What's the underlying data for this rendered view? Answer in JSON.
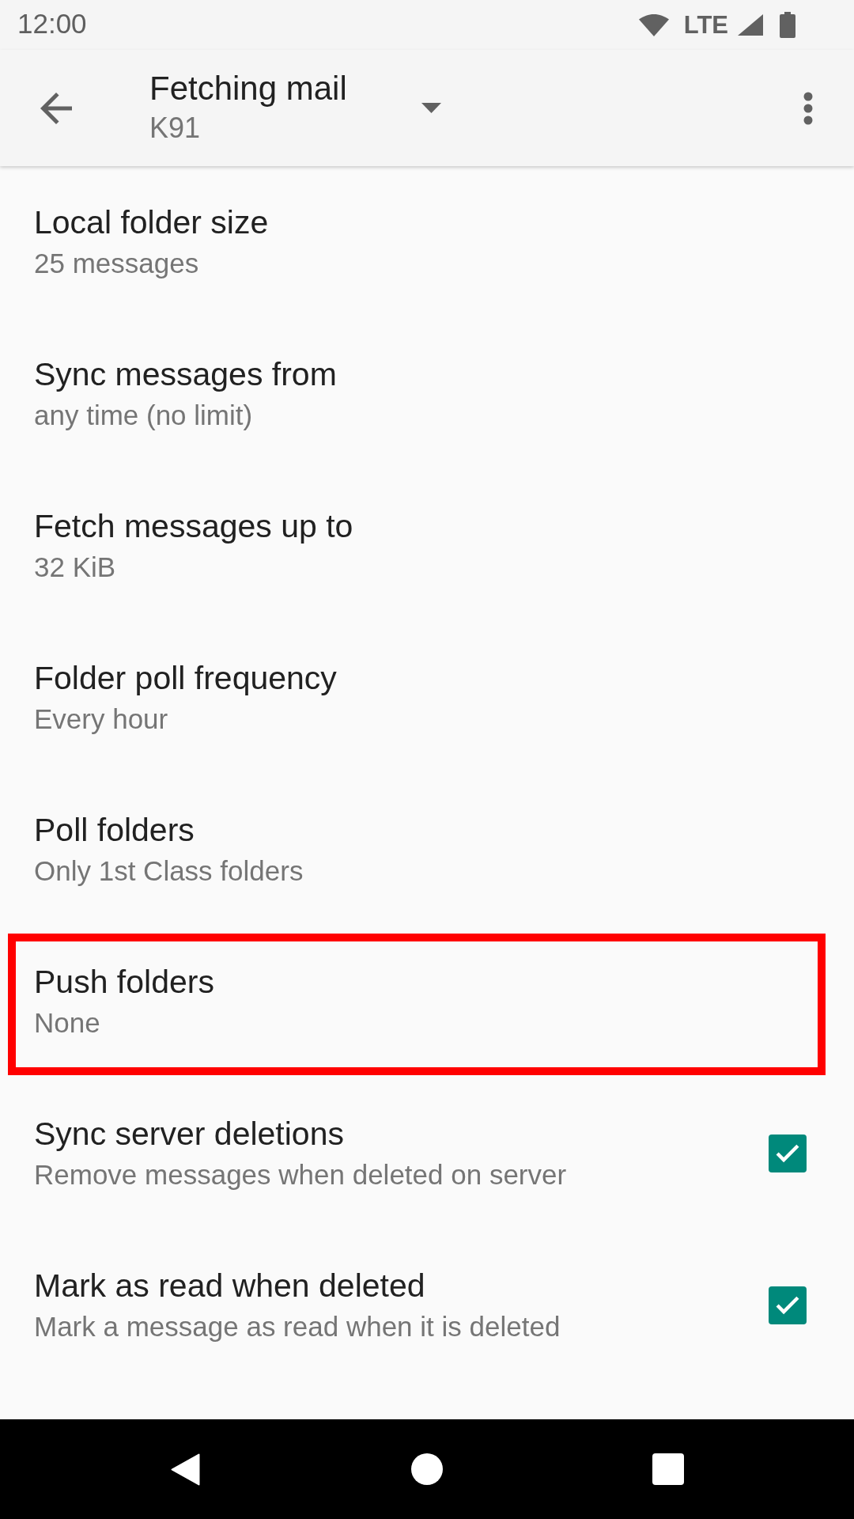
{
  "status_bar": {
    "time": "12:00",
    "network": "LTE"
  },
  "app_bar": {
    "title": "Fetching mail",
    "subtitle": "K91"
  },
  "settings": [
    {
      "kind": "text",
      "title": "Local folder size",
      "summary": "25 messages",
      "highlighted": false
    },
    {
      "kind": "text",
      "title": "Sync messages from",
      "summary": "any time (no limit)",
      "highlighted": false
    },
    {
      "kind": "text",
      "title": "Fetch messages up to",
      "summary": "32 KiB",
      "highlighted": false
    },
    {
      "kind": "text",
      "title": "Folder poll frequency",
      "summary": "Every hour",
      "highlighted": false
    },
    {
      "kind": "text",
      "title": "Poll folders",
      "summary": "Only 1st Class folders",
      "highlighted": false
    },
    {
      "kind": "text",
      "title": "Push folders",
      "summary": "None",
      "highlighted": true
    },
    {
      "kind": "checkbox",
      "title": "Sync server deletions",
      "summary": "Remove messages when deleted on server",
      "checked": true,
      "highlighted": false
    },
    {
      "kind": "checkbox",
      "title": "Mark as read when deleted",
      "summary": "Mark a message as read when it is deleted",
      "checked": true,
      "highlighted": false
    }
  ]
}
